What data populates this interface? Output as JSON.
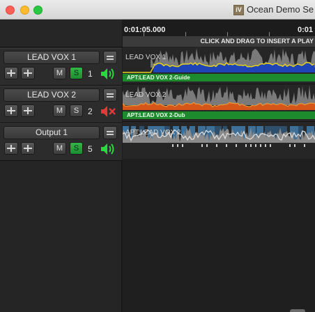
{
  "window": {
    "title": "Ocean Demo Se",
    "app_icon_text": "iV"
  },
  "ruler": {
    "time_a": "0:01:05.000",
    "time_b": "0:01"
  },
  "insert_hint": "CLICK AND DRAG TO INSERT A PLAY",
  "tracks": [
    {
      "name": "LEAD VOX 1",
      "mute_label": "M",
      "solo_label": "S",
      "solo_active": true,
      "number": "1",
      "speaker_state": "speaker-on-icon",
      "speaker_color": "#2bd93f"
    },
    {
      "name": "LEAD VOX 2",
      "mute_label": "M",
      "solo_label": "S",
      "solo_active": false,
      "number": "2",
      "speaker_state": "speaker-muted-icon",
      "speaker_color": "#e23a3a"
    },
    {
      "name": "Output 1",
      "mute_label": "M",
      "solo_label": "S",
      "solo_active": true,
      "number": "5",
      "speaker_state": "speaker-on-icon",
      "speaker_color": "#2bd93f"
    }
  ],
  "lanes": [
    {
      "title": "LEAD VOX 1",
      "footer": "APT:LEAD VOX 2-Guide",
      "fill_color": "#1f44b8",
      "line_color": "#e6d21e"
    },
    {
      "title": "LEAD VOX 2",
      "footer": "APT:LEAD VOX 2-Dub",
      "fill_color": "#d6561a",
      "line_color": "#e89a3a"
    },
    {
      "title": "APT:LEAD VOX 2",
      "footer": "",
      "fill_color": "#3e6f97",
      "line_color": "#dcdcdc"
    }
  ]
}
